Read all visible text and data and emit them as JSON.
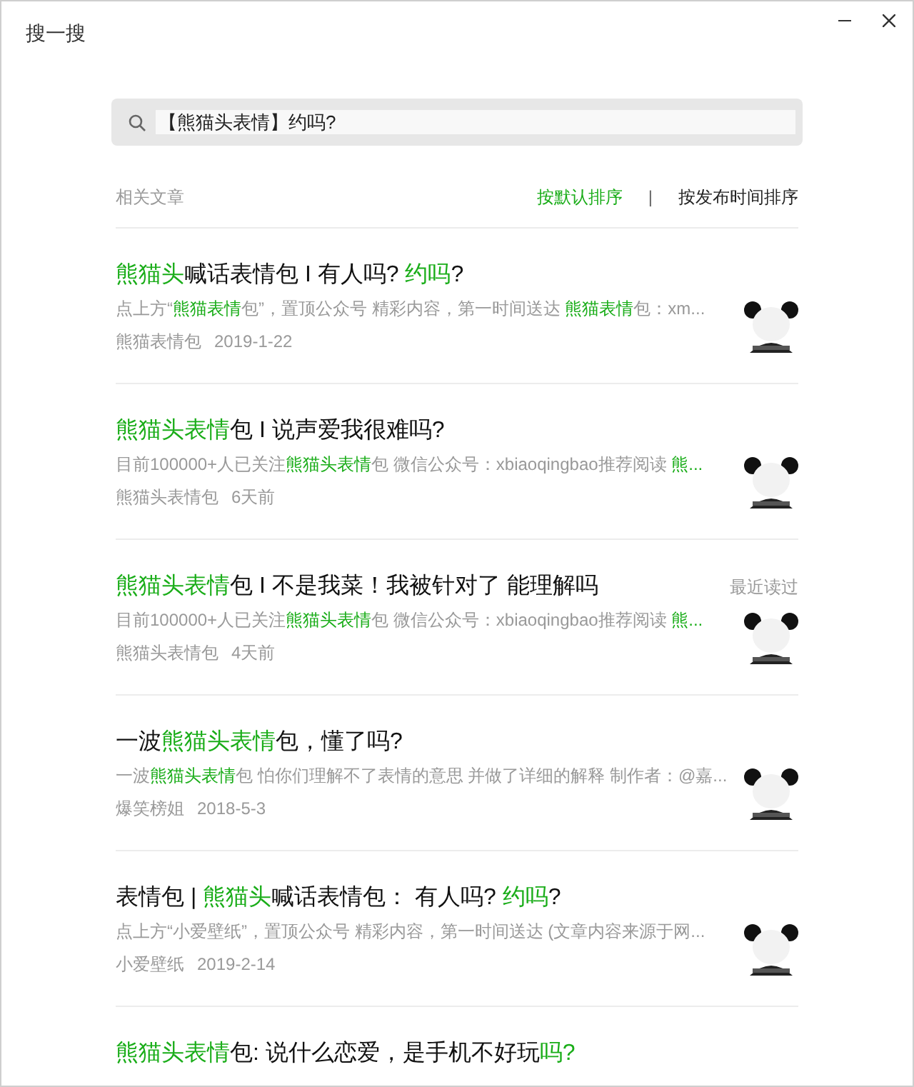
{
  "window": {
    "title": "搜一搜"
  },
  "search": {
    "value": "【熊猫头表情】约吗?"
  },
  "section_label": "相关文章",
  "sort_options": [
    {
      "label": "按默认排序",
      "selected": true
    },
    {
      "label": "按发布时间排序",
      "selected": false
    }
  ],
  "sort_separator": "|",
  "results": [
    {
      "title": [
        {
          "text": "熊猫头",
          "highlight": true
        },
        {
          "text": "喊话表情包 I 有人吗? ",
          "highlight": false
        },
        {
          "text": "约吗",
          "highlight": true
        },
        {
          "text": "?",
          "highlight": false
        }
      ],
      "snippet": [
        {
          "text": "点上方“",
          "highlight": false
        },
        {
          "text": "熊猫表情",
          "highlight": true
        },
        {
          "text": "包”，置顶公众号 精彩内容，第一时间送达 ",
          "highlight": false
        },
        {
          "text": "熊猫表情",
          "highlight": true
        },
        {
          "text": "包：xm...",
          "highlight": false
        }
      ],
      "source": "熊猫表情包",
      "date": "2019-1-22"
    },
    {
      "title": [
        {
          "text": "熊猫头表情",
          "highlight": true
        },
        {
          "text": "包 I 说声爱我很难吗?",
          "highlight": false
        }
      ],
      "snippet": [
        {
          "text": "目前100000+人已关注",
          "highlight": false
        },
        {
          "text": "熊猫头表情",
          "highlight": true
        },
        {
          "text": "包 微信公众号：xbiaoqingbao推荐阅读 ",
          "highlight": false
        },
        {
          "text": "熊...",
          "highlight": true
        }
      ],
      "source": "熊猫头表情包",
      "date": "6天前"
    },
    {
      "title": [
        {
          "text": "熊猫头表情",
          "highlight": true
        },
        {
          "text": "包 I 不是我菜！我被针对了 能理解吗",
          "highlight": false
        }
      ],
      "badge": "最近读过",
      "snippet": [
        {
          "text": "目前100000+人已关注",
          "highlight": false
        },
        {
          "text": "熊猫头表情",
          "highlight": true
        },
        {
          "text": "包 微信公众号：xbiaoqingbao推荐阅读 ",
          "highlight": false
        },
        {
          "text": "熊...",
          "highlight": true
        }
      ],
      "source": "熊猫头表情包",
      "date": "4天前"
    },
    {
      "title": [
        {
          "text": "一波",
          "highlight": false
        },
        {
          "text": "熊猫头表情",
          "highlight": true
        },
        {
          "text": "包，懂了吗?",
          "highlight": false
        }
      ],
      "snippet": [
        {
          "text": "一波",
          "highlight": false
        },
        {
          "text": "熊猫头表情",
          "highlight": true
        },
        {
          "text": "包 怕你们理解不了表情的意思 并做了详细的解释 制作者：@嘉...",
          "highlight": false
        }
      ],
      "source": "爆笑榜姐",
      "date": "2018-5-3"
    },
    {
      "title": [
        {
          "text": "表情包 | ",
          "highlight": false
        },
        {
          "text": "熊猫头",
          "highlight": true
        },
        {
          "text": "喊话表情包： 有人吗? ",
          "highlight": false
        },
        {
          "text": "约吗",
          "highlight": true
        },
        {
          "text": "?",
          "highlight": false
        }
      ],
      "snippet": [
        {
          "text": "点上方“小爱壁纸”，置顶公众号 精彩内容，第一时间送达 (文章内容来源于网...",
          "highlight": false
        }
      ],
      "source": "小爱壁纸",
      "date": "2019-2-14"
    },
    {
      "title": [
        {
          "text": "熊猫头表情",
          "highlight": true
        },
        {
          "text": "包: 说什么恋爱，是手机不好玩",
          "highlight": false
        },
        {
          "text": "吗?",
          "highlight": true
        }
      ]
    }
  ]
}
